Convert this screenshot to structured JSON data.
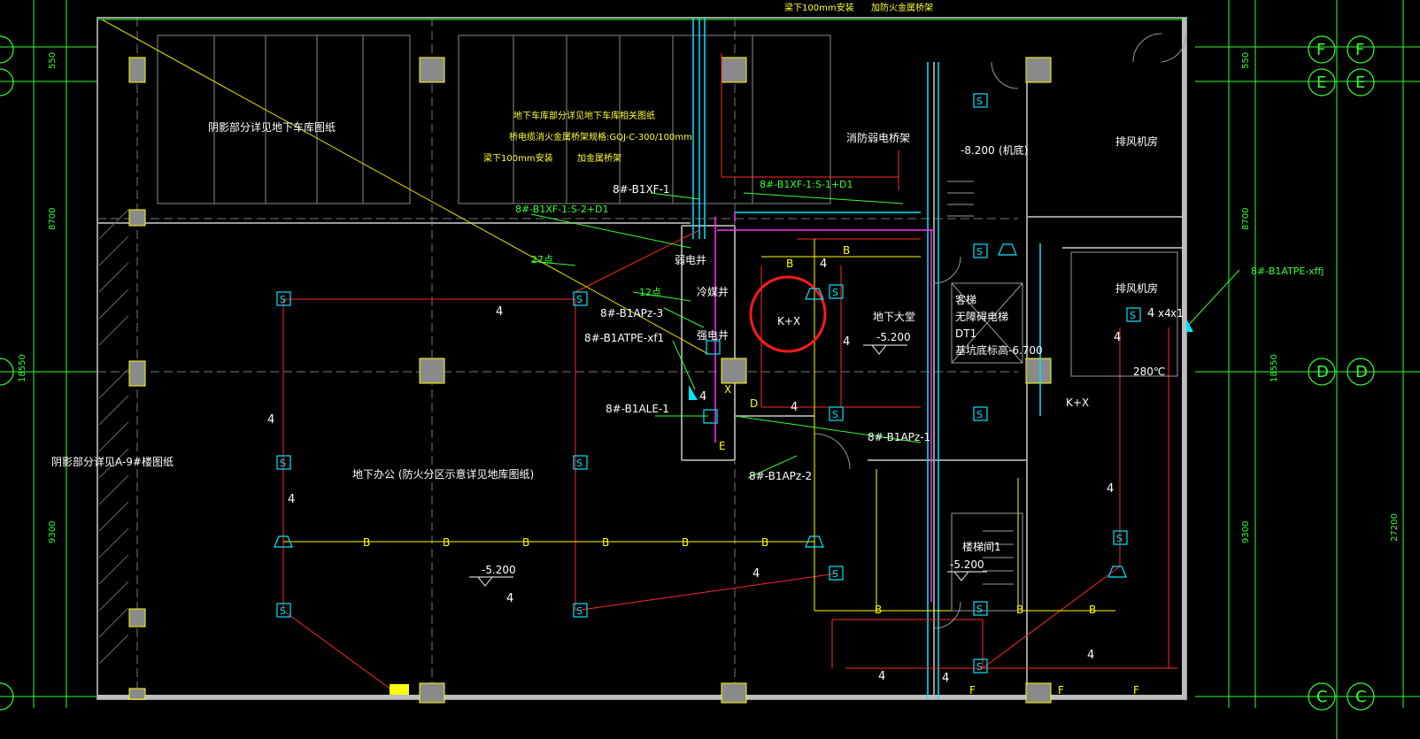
{
  "drawing": {
    "rooms": {
      "shadow_garage": "阴影部分详见地下车库图纸",
      "shadow_9": "阴影部分详见A-9#楼图纸",
      "office": "地下办公 (防火分区示意详见地库图纸)",
      "fan_room_top": "排风机房",
      "fan_room_mid": "排风机房",
      "lobby": "地下大堂",
      "stair": "楼梯间1",
      "elevator_1": "客梯",
      "elevator_2": "无障碍电梯",
      "elevator_3": "DT1",
      "elevator_4": "基坑底标高-6.700",
      "weak_shaft": "弱电井",
      "cold_shaft": "冷媒井",
      "strong_shaft": "强电井",
      "pit": "(机底)"
    },
    "notes": {
      "top_1": "梁下100mm安装",
      "top_2": "加防火金属桥架",
      "mid_1": "地下车库部分详见地下车库相关图纸",
      "mid_2": "桥电缆消火金属桥架规格:GQJ-C-300/100mm",
      "mid_3": "梁下100mm安装",
      "mid_4": "加金属桥架",
      "mid_5": "消防弱电桥架",
      "n27": "27点",
      "n12": "12点"
    },
    "circuits": {
      "c1": "8#-B1XF-1",
      "c2": "8#-B1XF-1:S-1+D1",
      "c3": "8#-B1XF-1:S-2+D1",
      "c4": "8#-B1APz-3",
      "c5": "8#-B1ATPE-xf1",
      "c6": "8#-B1ALE-1",
      "c7": "8#-B1APz-1",
      "c8": "8#-B1APz-2",
      "c9": "8#-B1ATPE-xffj"
    },
    "levels": {
      "l1": "-8.200",
      "l2": "-5.200",
      "l3": "-5.200",
      "l4": "-5.200",
      "temp": "280℃"
    },
    "grid_labels": {
      "F": "F",
      "E": "E",
      "D": "D",
      "C": "C"
    },
    "dims_left": [
      "550",
      "8700",
      "18550",
      "9300"
    ],
    "dims_right": [
      "550",
      "8700",
      "18550",
      "9300",
      "27200"
    ],
    "symbols": {
      "b": "B",
      "s": "S",
      "k": "K+X",
      "d": "D",
      "e": "E",
      "f": "F",
      "four": "4",
      "x1": "x1",
      "x4": "x4",
      "x": "X"
    },
    "colors": {
      "background": "#000000",
      "wall": "#9a9a9a",
      "grid_line": "#33ff33",
      "wire_red": "#ff2a2a",
      "wire_yellow": "#ffff00",
      "cyan": "#00e5ff",
      "magenta": "#ff33ff",
      "highlight_circle": "#ff1a1a"
    }
  }
}
